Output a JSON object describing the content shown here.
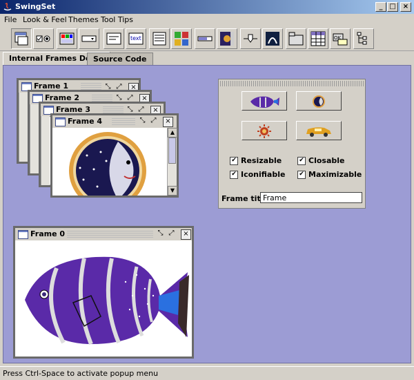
{
  "window": {
    "title": "SwingSet"
  },
  "menu": {
    "items": [
      "File",
      "Look & Feel",
      "Themes",
      "Tool Tips"
    ]
  },
  "toolbar": {
    "buttons": [
      "internal-frames",
      "checkbox-radio",
      "combobox",
      "button",
      "list",
      "text-editor",
      "option-pane",
      "progress-bar",
      "scroll-pane",
      "slider",
      "split-pane",
      "tabbed-pane",
      "table",
      "tooltip",
      "tree"
    ],
    "selected_index": 0
  },
  "tabs": [
    {
      "label": "Internal Frames Demo",
      "active": true
    },
    {
      "label": "Source Code",
      "active": false
    }
  ],
  "frames": [
    {
      "title": "Frame 1"
    },
    {
      "title": "Frame 2"
    },
    {
      "title": "Frame 3"
    },
    {
      "title": "Frame 4"
    },
    {
      "title": "Frame 0"
    }
  ],
  "palette": {
    "icon_buttons": [
      "fish",
      "moon",
      "sun",
      "car"
    ],
    "checkboxes": [
      {
        "label": "Resizable",
        "checked": true
      },
      {
        "label": "Closable",
        "checked": true
      },
      {
        "label": "Iconifiable",
        "checked": true
      },
      {
        "label": "Maximizable",
        "checked": true
      }
    ],
    "frame_title_label": "Frame title:",
    "frame_title_value": "Frame"
  },
  "status": {
    "text": "Press Ctrl-Space to activate popup menu"
  },
  "colors": {
    "desktop": "#9c9cd4",
    "title_start": "#0a246a",
    "title_end": "#a6caf0"
  }
}
